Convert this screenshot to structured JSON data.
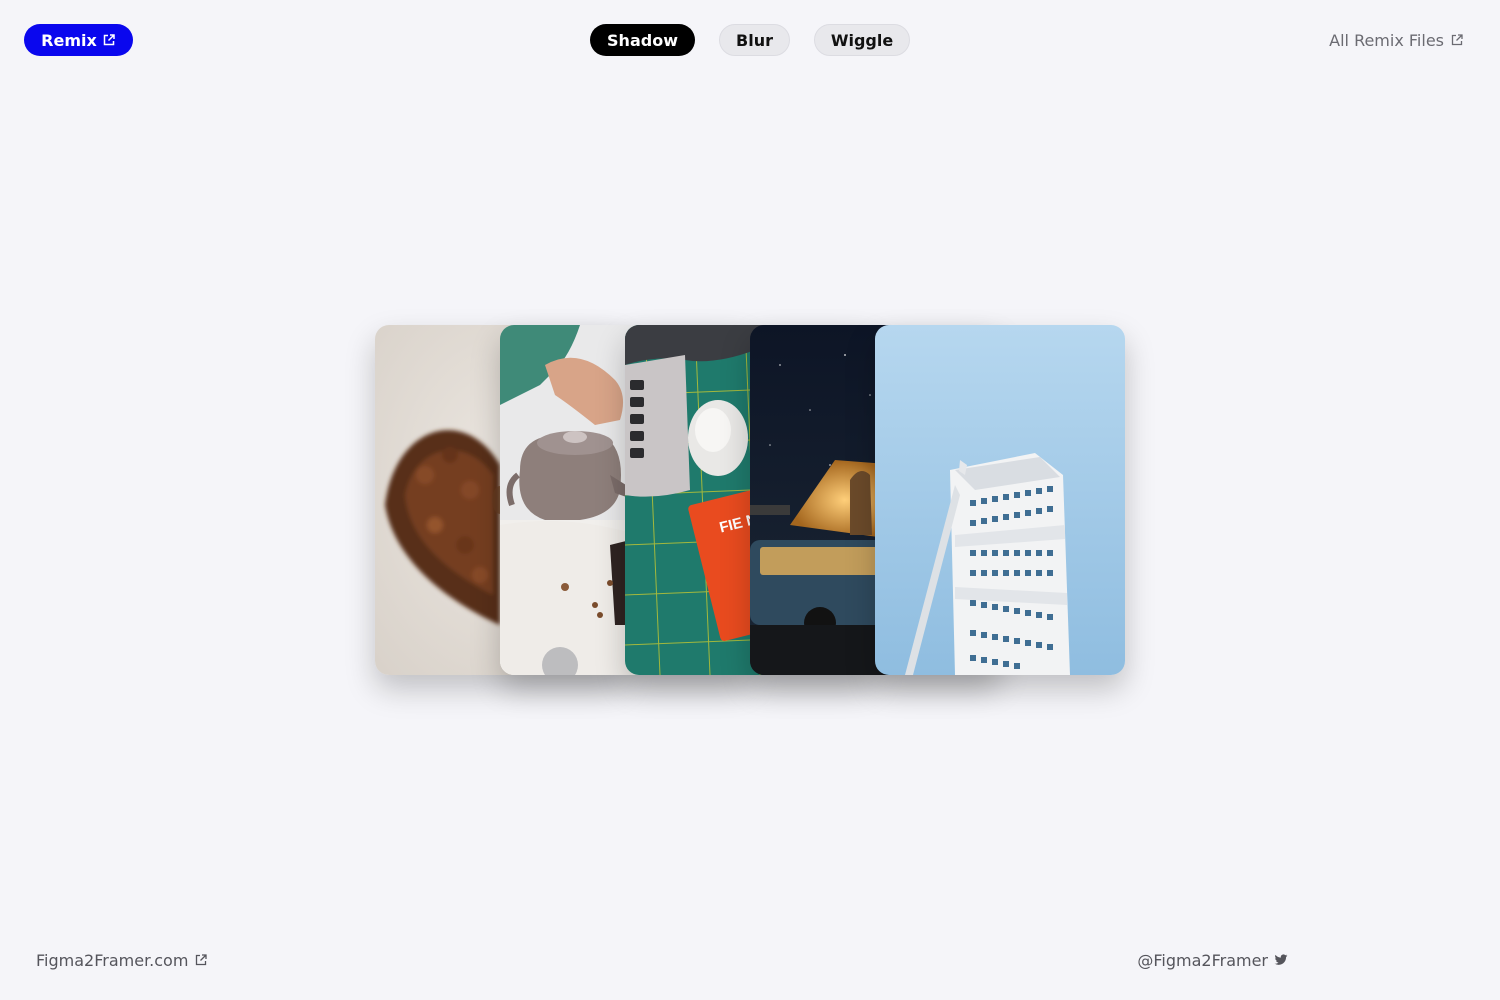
{
  "header": {
    "remix_label": "Remix",
    "all_files_label": "All Remix Files"
  },
  "tabs": [
    {
      "label": "Shadow",
      "active": true
    },
    {
      "label": "Blur",
      "active": false
    },
    {
      "label": "Wiggle",
      "active": false
    }
  ],
  "gallery": {
    "cards": [
      {
        "subject": "coffee beans heart"
      },
      {
        "subject": "pouring kettle"
      },
      {
        "subject": "laptop, mouse and notebook on cutting mat"
      },
      {
        "subject": "van camping under night sky"
      },
      {
        "subject": "twisting white tower against blue sky"
      }
    ],
    "notebook_text": "FIE NO"
  },
  "footer": {
    "site_label": "Figma2Framer.com",
    "handle_label": "@Figma2Framer"
  },
  "colors": {
    "remix_button": "#0a07ee",
    "active_tab": "#000000",
    "background": "#f5f5f9"
  },
  "icons": [
    "external-link-icon",
    "twitter-icon"
  ]
}
